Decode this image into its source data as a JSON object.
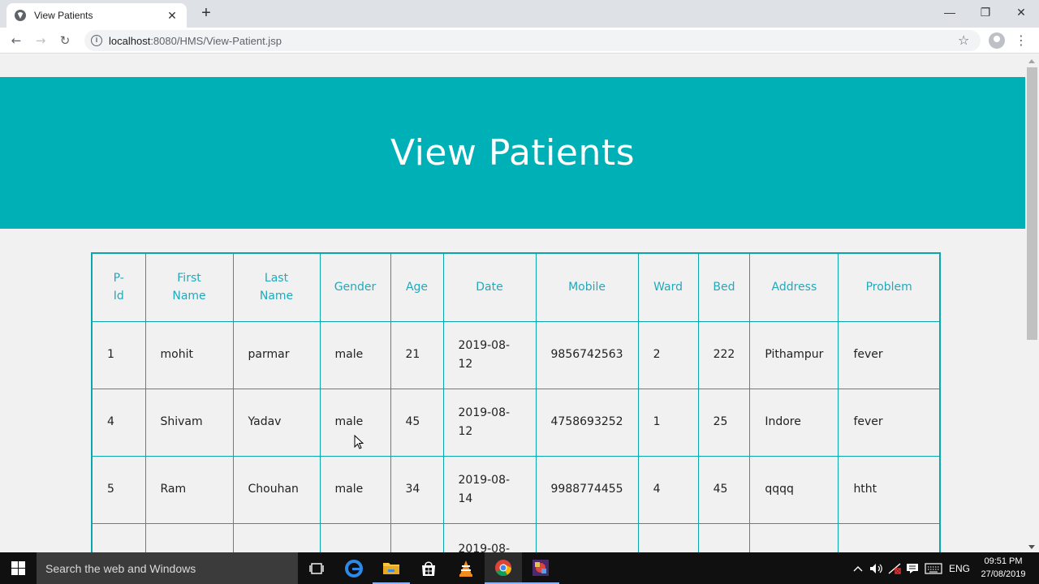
{
  "browser": {
    "tab_title": "View Patients",
    "tab_close": "✕",
    "new_tab": "+",
    "url_host": "localhost",
    "url_path": ":8080/HMS/View-Patient.jsp",
    "window_controls": {
      "minimize": "—",
      "restore": "❐",
      "close": "✕"
    },
    "nav": {
      "back": "←",
      "forward": "→",
      "reload": "↻"
    },
    "info": "i",
    "star": "☆",
    "menu": "⋮"
  },
  "page": {
    "heading": "View Patients",
    "banner_color": "#00b0b7",
    "table": {
      "headers": [
        "P-Id",
        "First Name",
        "Last Name",
        "Gender",
        "Age",
        "Date",
        "Mobile",
        "Ward",
        "Bed",
        "Address",
        "Problem"
      ],
      "header_lines": [
        [
          "P-",
          "Id"
        ],
        [
          "First",
          "Name"
        ],
        [
          "Last",
          "Name"
        ],
        [
          "Gender"
        ],
        [
          "Age"
        ],
        [
          "Date"
        ],
        [
          "Mobile"
        ],
        [
          "Ward"
        ],
        [
          "Bed"
        ],
        [
          "Address"
        ],
        [
          "Problem"
        ]
      ],
      "rows": [
        [
          "1",
          "mohit",
          "parmar",
          "male",
          "21",
          "2019-08-12",
          "9856742563",
          "2",
          "222",
          "Pithampur",
          "fever"
        ],
        [
          "4",
          "Shivam",
          "Yadav",
          "male",
          "45",
          "2019-08-12",
          "4758693252",
          "1",
          "25",
          "Indore",
          "fever"
        ],
        [
          "5",
          "Ram",
          "Chouhan",
          "male",
          "34",
          "2019-08-14",
          "9988774455",
          "4",
          "45",
          "qqqq",
          "htht"
        ],
        [
          "",
          "",
          "",
          "",
          "",
          "2019-08-",
          "",
          "",
          "",
          "",
          ""
        ]
      ]
    }
  },
  "taskbar": {
    "search_placeholder": "Search the web and Windows",
    "language": "ENG",
    "time": "09:51 PM",
    "date": "27/08/2019"
  }
}
